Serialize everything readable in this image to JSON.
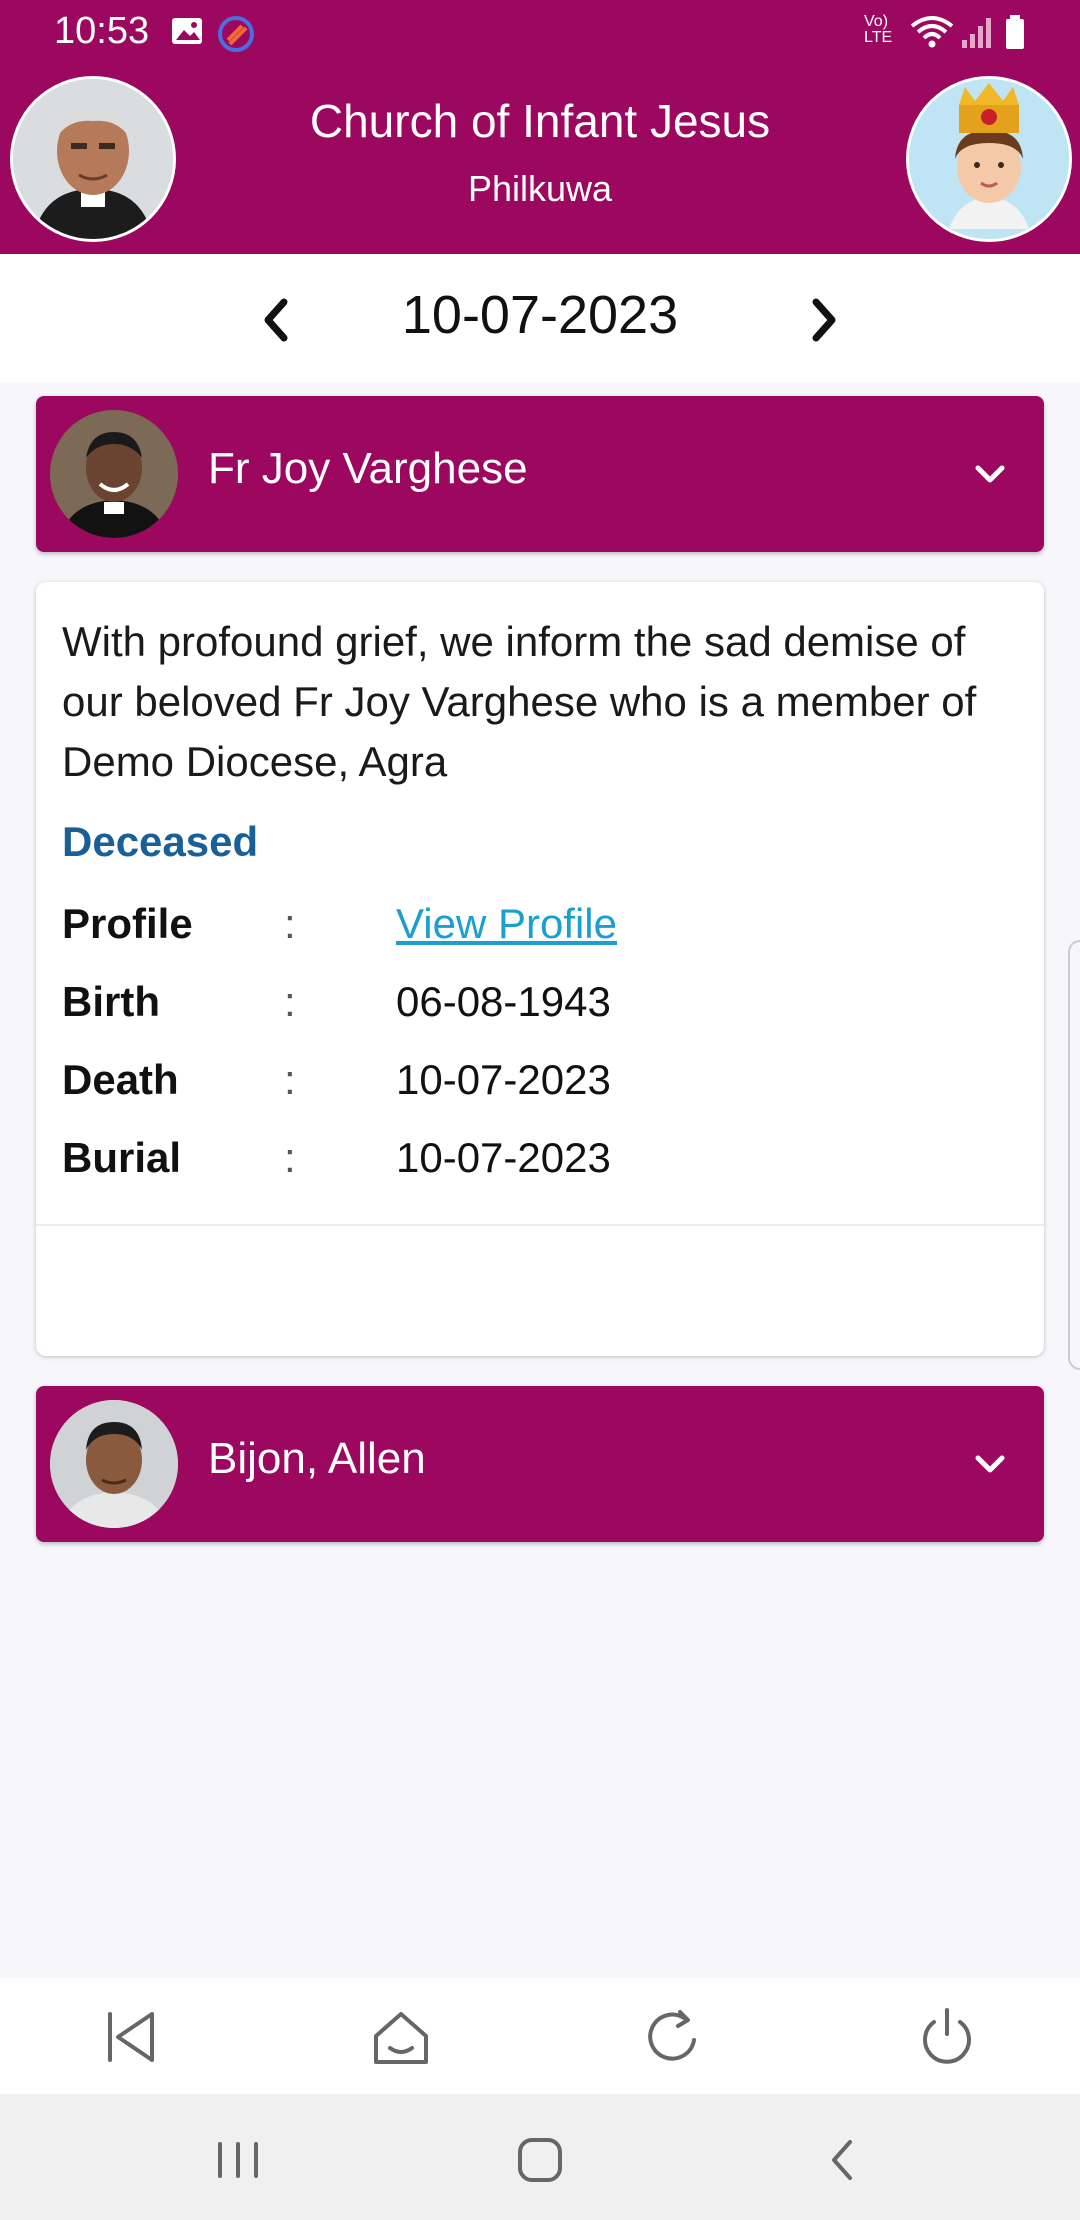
{
  "status_bar": {
    "time": "10:53",
    "network_label": "Vo) LTE",
    "icons": [
      "image-icon",
      "app-notification-icon",
      "volte-icon",
      "wifi-icon",
      "signal-icon",
      "battery-icon"
    ]
  },
  "header": {
    "title": "Church of Infant Jesus",
    "subtitle": "Philkuwa",
    "left_avatar": "priest-avatar",
    "right_avatar": "infant-jesus-avatar"
  },
  "date_nav": {
    "date": "10-07-2023"
  },
  "people": [
    {
      "name": "Fr Joy Varghese",
      "expanded": true,
      "message": "With profound grief, we inform the sad demise of our beloved Fr Joy Varghese who is a member of Demo Diocese, Agra",
      "status": "Deceased",
      "fields": [
        {
          "label": "Profile",
          "colon": ":",
          "value": "View Profile",
          "is_link": true
        },
        {
          "label": "Birth",
          "colon": ":",
          "value": "06-08-1943",
          "is_link": false
        },
        {
          "label": "Death",
          "colon": ":",
          "value": "10-07-2023",
          "is_link": false
        },
        {
          "label": "Burial",
          "colon": ":",
          "value": "10-07-2023",
          "is_link": false
        }
      ]
    },
    {
      "name": "Bijon, Allen",
      "expanded": false
    }
  ],
  "bottom_nav": [
    "back-to-start-icon",
    "home-icon",
    "refresh-icon",
    "power-icon"
  ],
  "system_nav": [
    "recent-apps-icon",
    "home-circle-icon",
    "back-icon"
  ],
  "colors": {
    "brand": "#9c0860",
    "status_text": "#1a5f96",
    "link": "#1a9fd0",
    "background": "#f6f6fb"
  }
}
